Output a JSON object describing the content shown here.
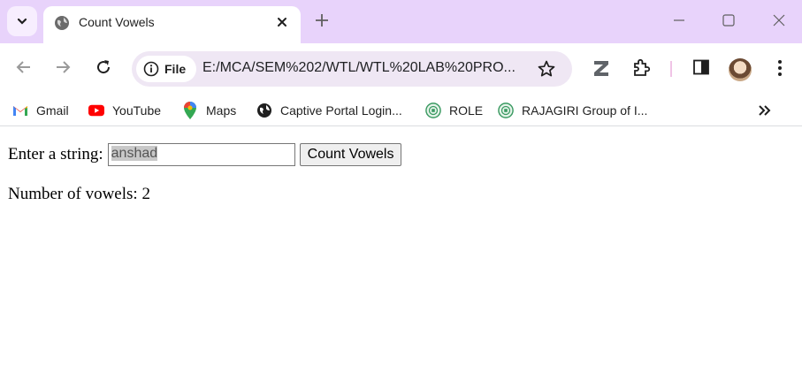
{
  "browser": {
    "tab": {
      "title": "Count Vowels"
    },
    "address": {
      "chip_label": "File",
      "url": "E:/MCA/SEM%202/WTL/WTL%20LAB%20PRO..."
    },
    "bookmarks": [
      {
        "label": "Gmail",
        "icon": "gmail-icon"
      },
      {
        "label": "YouTube",
        "icon": "youtube-icon"
      },
      {
        "label": "Maps",
        "icon": "maps-icon"
      },
      {
        "label": "Captive Portal Login...",
        "icon": "globe-icon"
      },
      {
        "label": "ROLE",
        "icon": "role-icon"
      },
      {
        "label": "RAJAGIRI Group of I...",
        "icon": "rajagiri-icon"
      }
    ],
    "colors": {
      "tabstrip": "#e8d3fb",
      "omnibox": "#efe7f4",
      "youtube_red": "#ff0000",
      "seal_green": "#3b9a62"
    }
  },
  "page": {
    "label": "Enter a string:",
    "input_value": "anshad",
    "button_label": "Count Vowels",
    "result_label": "Number of vowels:",
    "result_value": "2"
  }
}
